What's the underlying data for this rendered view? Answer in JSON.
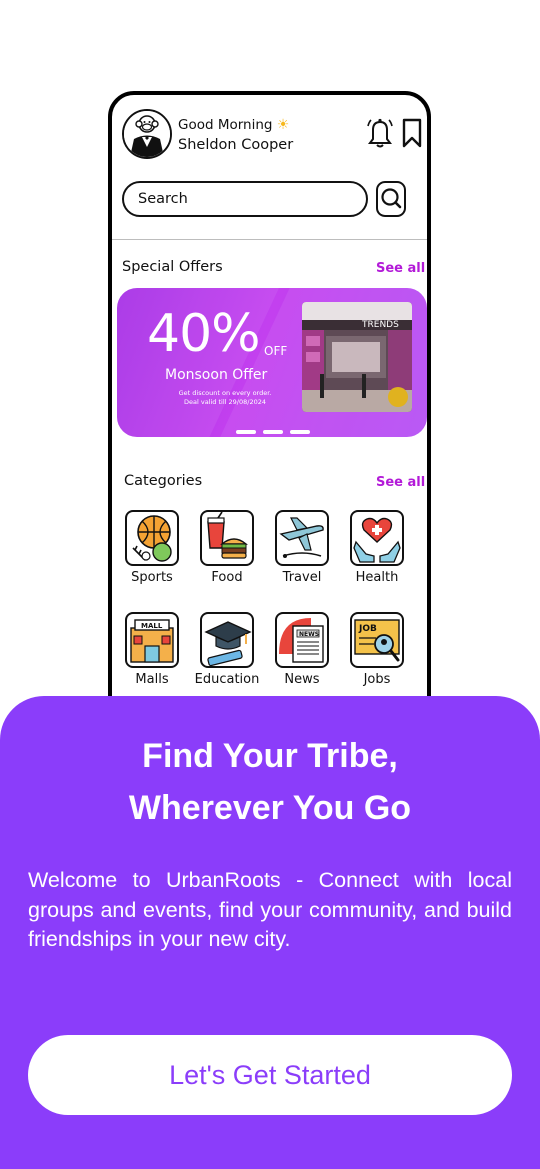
{
  "header": {
    "greeting": "Good Morning",
    "user_name": "Sheldon Cooper"
  },
  "search": {
    "placeholder": "Search"
  },
  "special_offers": {
    "title": "Special Offers",
    "see_all": "See all",
    "banner": {
      "discount": "40%",
      "off_label": "OFF",
      "offer_name": "Monsoon Offer",
      "line1": "Get discount on every order.",
      "line2": "Deal valid till 29/08/2024",
      "store_sign": "TRENDS"
    }
  },
  "categories": {
    "title": "Categories",
    "see_all": "See all",
    "items": [
      {
        "label": "Sports",
        "icon": "sports-icon"
      },
      {
        "label": "Food",
        "icon": "food-icon"
      },
      {
        "label": "Travel",
        "icon": "travel-icon"
      },
      {
        "label": "Health",
        "icon": "health-icon"
      },
      {
        "label": "Malls",
        "icon": "malls-icon"
      },
      {
        "label": "Education",
        "icon": "education-icon"
      },
      {
        "label": "News",
        "icon": "news-icon"
      },
      {
        "label": "Jobs",
        "icon": "jobs-icon"
      }
    ],
    "mall_sign": "MALL",
    "news_sign": "NEWS",
    "job_sign": "JOB"
  },
  "onboarding": {
    "headline_line1": "Find Your Tribe,",
    "headline_line2": "Wherever You Go",
    "body": "Welcome to UrbanRoots - Connect with local groups and events, find your community, and build friendships in your new city.",
    "cta": "Let's Get Started"
  },
  "colors": {
    "accent": "#8b3dfa",
    "see_all": "#b31bd8",
    "banner": "#b640ee"
  }
}
